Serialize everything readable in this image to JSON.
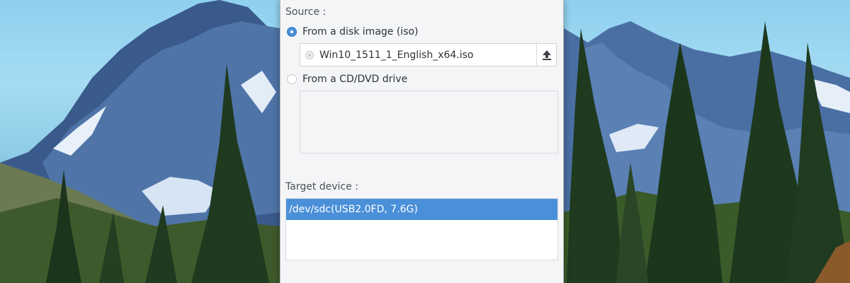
{
  "dialog": {
    "source_label": "Source :",
    "option_disk_image": "From a disk image (iso)",
    "iso_file_name": "Win10_1511_1_English_x64.iso",
    "option_cd_dvd": "From a CD/DVD drive",
    "target_label": "Target device :",
    "devices": [
      "/dev/sdc(USB2.0FD,  7.6G)"
    ]
  },
  "icons": {
    "upload": "upload-icon",
    "file": "disc-icon"
  },
  "colors": {
    "accent": "#4a90d9",
    "dialog_bg": "#f4f5f7"
  }
}
